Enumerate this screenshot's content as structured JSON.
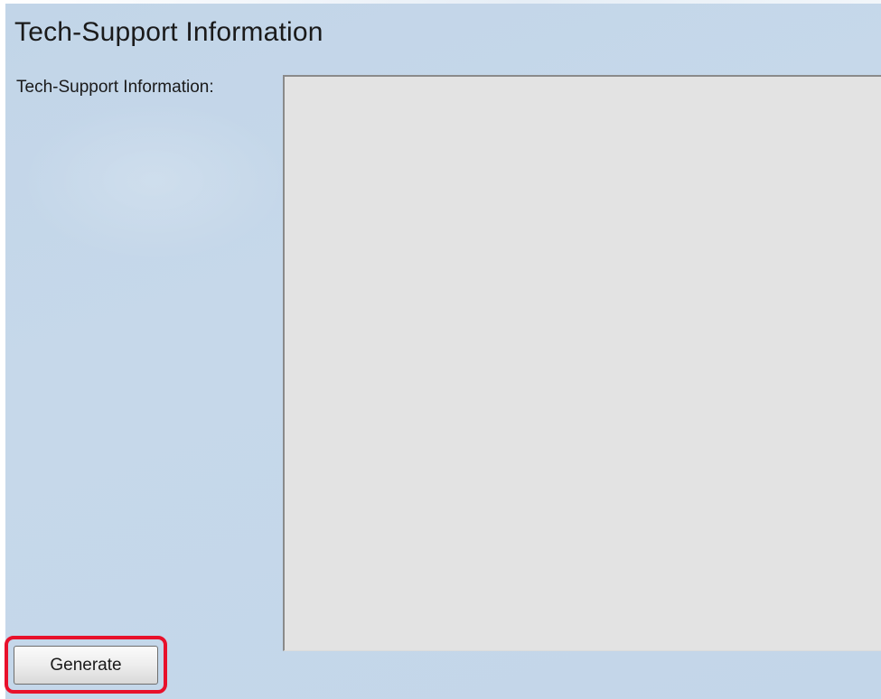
{
  "page": {
    "title": "Tech-Support Information"
  },
  "form": {
    "field_label": "Tech-Support Information:",
    "textarea_value": ""
  },
  "actions": {
    "generate_label": "Generate"
  },
  "colors": {
    "background": "#c4d7ea",
    "textarea_background": "#e3e3e3",
    "highlight": "#e8102b"
  }
}
